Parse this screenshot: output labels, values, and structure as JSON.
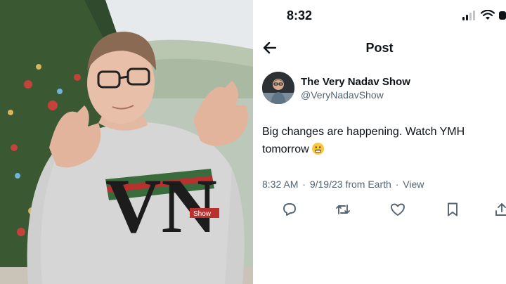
{
  "photo": {
    "shirt_logo_text": "VN",
    "shirt_tag_text": "Show"
  },
  "status_bar": {
    "time": "8:32",
    "icons": [
      "signal-icon",
      "wifi-icon",
      "battery-icon"
    ]
  },
  "nav": {
    "title": "Post",
    "back_icon": "arrow-left-icon"
  },
  "tweet": {
    "author_name": "The Very Nadav Show",
    "author_handle": "@VeryNadavShow",
    "text": "Big changes are happening. Watch YMH tomorrow",
    "emoji": "grimacing-face-emoji",
    "time": "8:32 AM",
    "date": "9/19/23",
    "source": "from Earth",
    "views_label": "View",
    "separator": "·"
  },
  "actions": [
    "reply-icon",
    "retweet-icon",
    "like-icon",
    "bookmark-icon",
    "share-icon"
  ],
  "colors": {
    "text_primary": "#0f1419",
    "text_secondary": "#536471",
    "emoji_yellow": "#f7c83b"
  }
}
